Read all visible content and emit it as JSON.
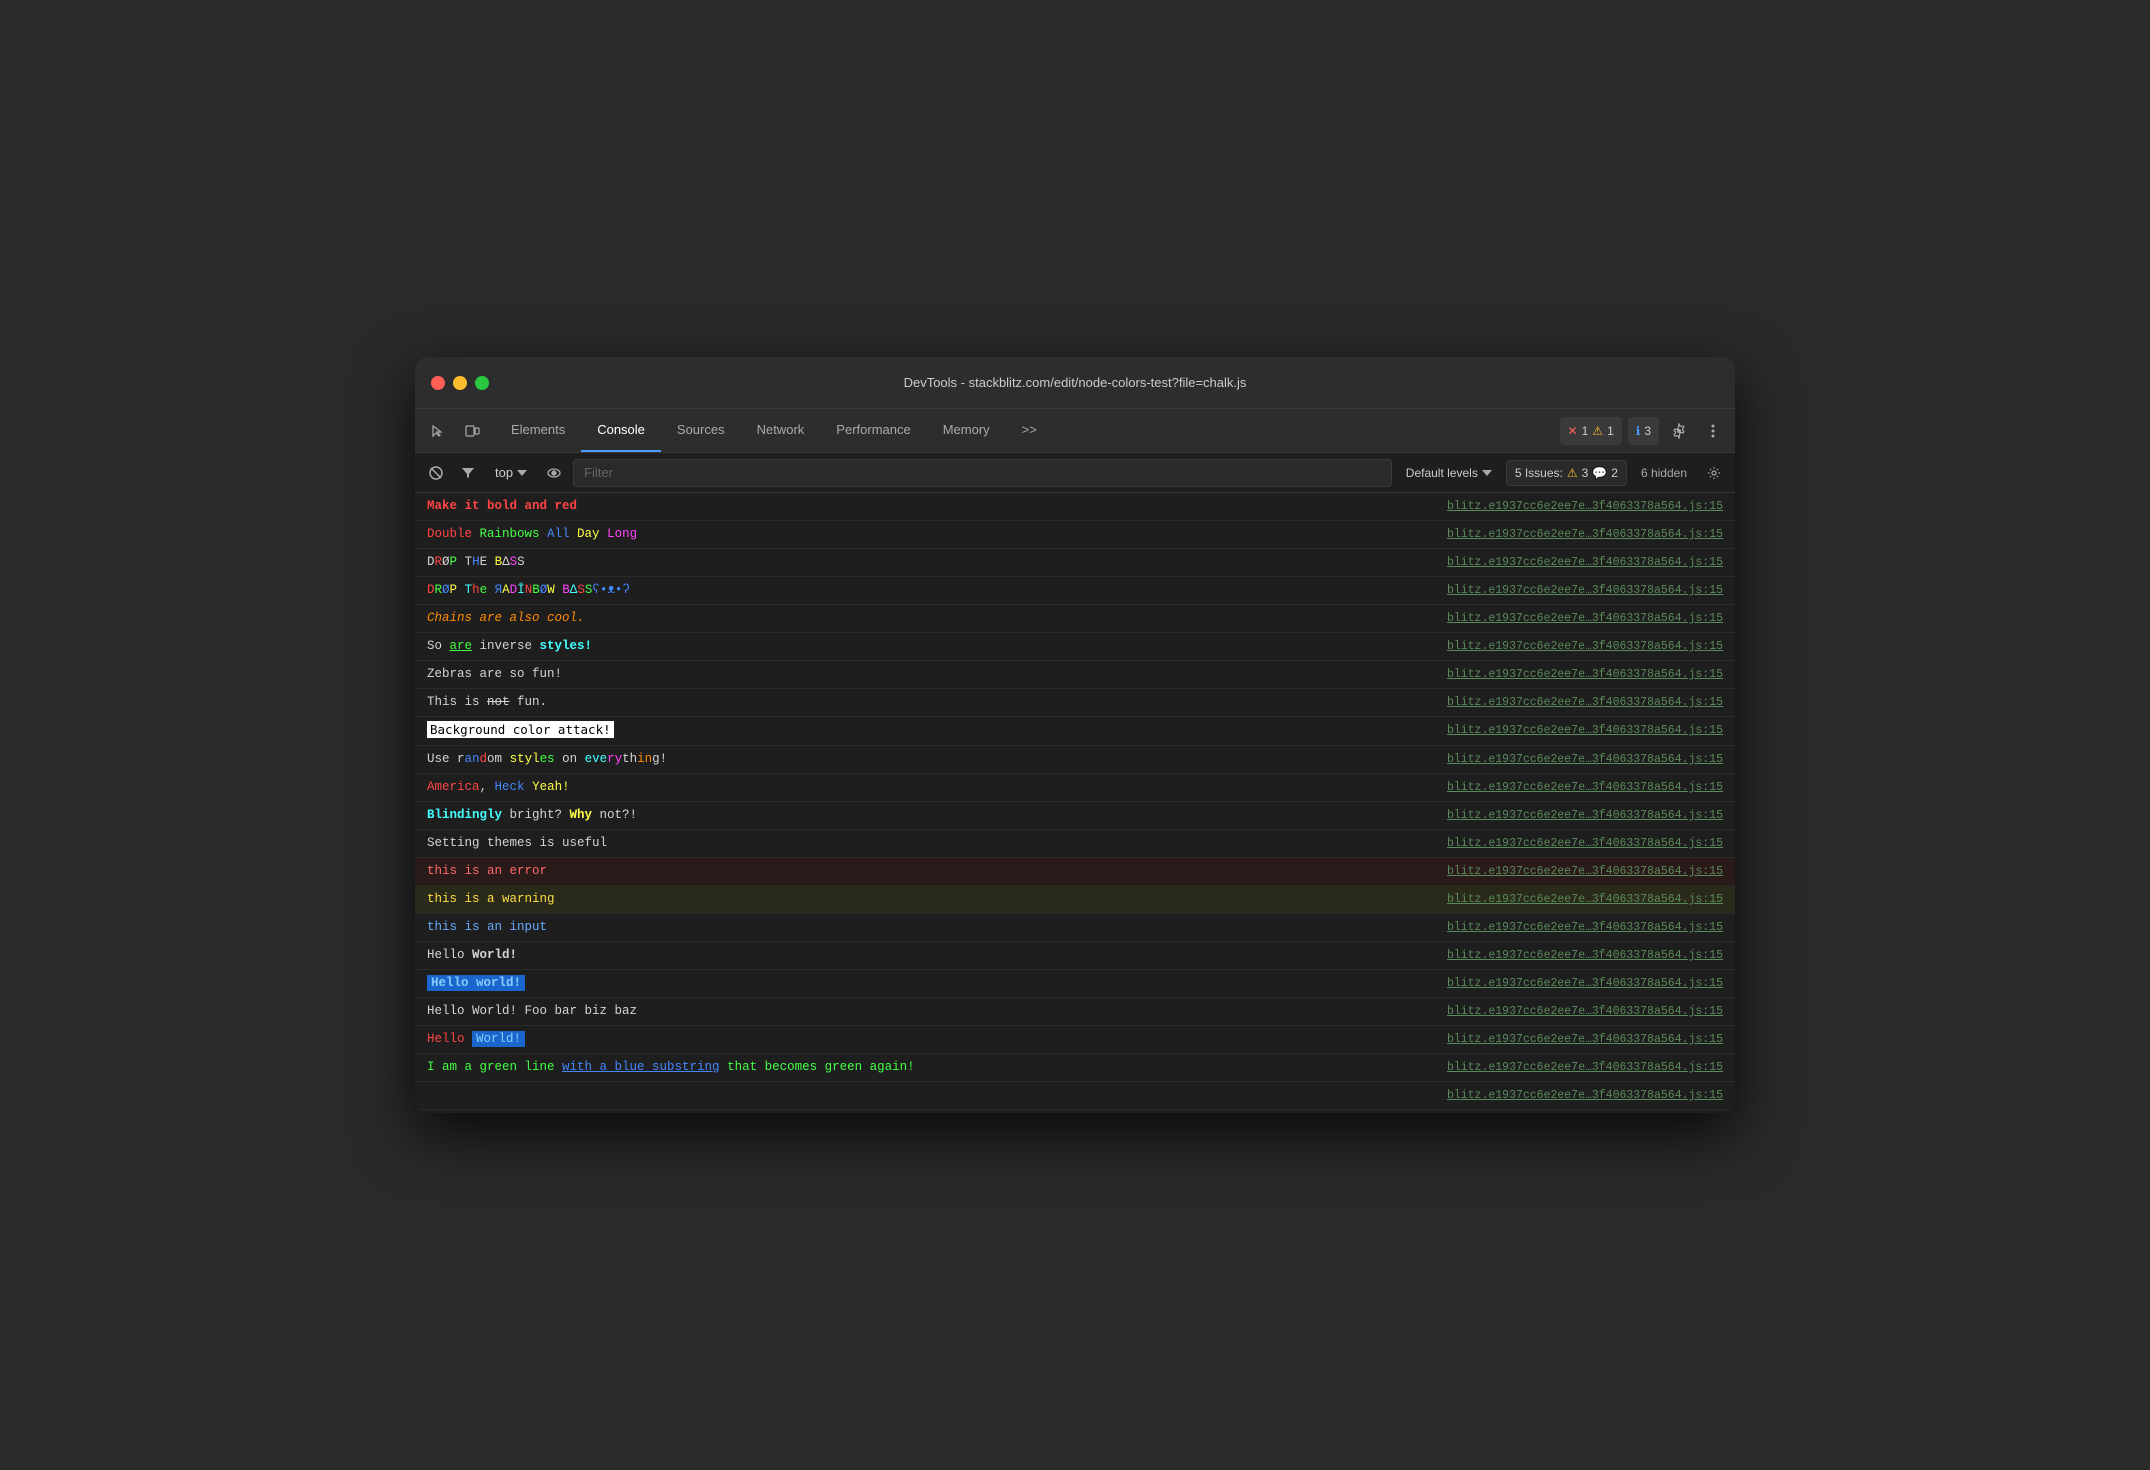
{
  "titlebar": {
    "title": "DevTools - stackblitz.com/edit/node-colors-test?file=chalk.js"
  },
  "tabs": {
    "items": [
      {
        "label": "Elements",
        "active": false
      },
      {
        "label": "Console",
        "active": true
      },
      {
        "label": "Sources",
        "active": false
      },
      {
        "label": "Network",
        "active": false
      },
      {
        "label": "Performance",
        "active": false
      },
      {
        "label": "Memory",
        "active": false
      }
    ],
    "more": ">>"
  },
  "badges": {
    "error_count": "1",
    "warning_count": "1",
    "info_count": "3",
    "issues_label": "5 Issues:",
    "issues_warning": "3",
    "issues_msg": "2",
    "hidden_label": "6 hidden"
  },
  "toolbar": {
    "top_label": "top",
    "filter_placeholder": "Filter",
    "default_levels_label": "Default levels"
  },
  "source_file": "blitz.e1937cc6e2ee7e…3f4063378a564.js:15",
  "log_rows": [
    {
      "id": 1,
      "type": "default"
    },
    {
      "id": 2,
      "type": "default"
    },
    {
      "id": 3,
      "type": "default"
    },
    {
      "id": 4,
      "type": "default"
    },
    {
      "id": 5,
      "type": "default"
    },
    {
      "id": 6,
      "type": "default"
    },
    {
      "id": 7,
      "type": "default"
    },
    {
      "id": 8,
      "type": "default"
    },
    {
      "id": 9,
      "type": "default"
    },
    {
      "id": 10,
      "type": "default"
    },
    {
      "id": 11,
      "type": "default"
    },
    {
      "id": 12,
      "type": "default"
    },
    {
      "id": 13,
      "type": "error"
    },
    {
      "id": 14,
      "type": "warning"
    },
    {
      "id": 15,
      "type": "input"
    },
    {
      "id": 16,
      "type": "default"
    },
    {
      "id": 17,
      "type": "default"
    },
    {
      "id": 18,
      "type": "default"
    },
    {
      "id": 19,
      "type": "default"
    },
    {
      "id": 20,
      "type": "default"
    },
    {
      "id": 21,
      "type": "default"
    }
  ]
}
